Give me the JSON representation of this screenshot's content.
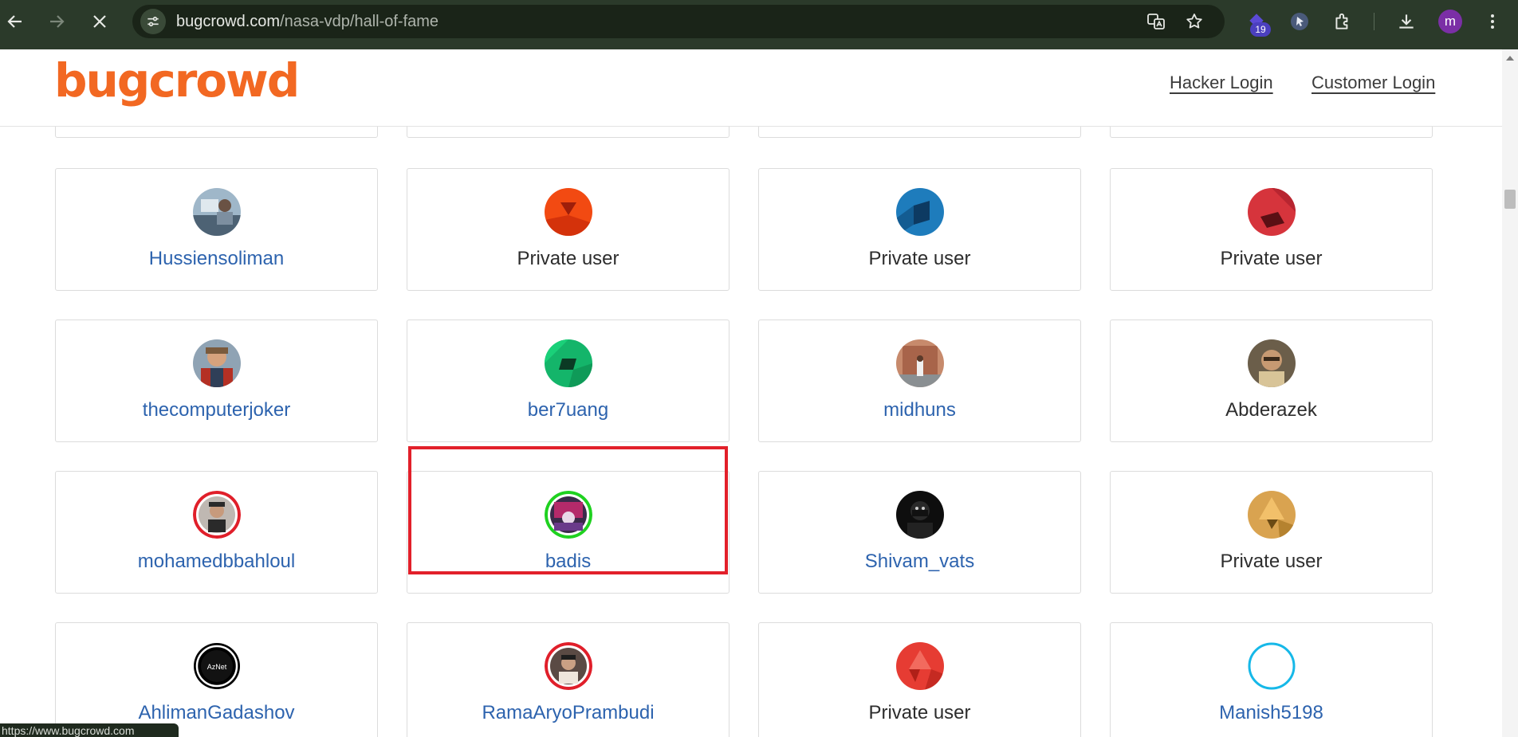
{
  "browser": {
    "url_host": "bugcrowd.com",
    "url_path": "/nasa-vdp/hall-of-fame",
    "extension_badge": "19",
    "profile_initial": "m",
    "status_url": "https://www.bugcrowd.com"
  },
  "header": {
    "logo": "bugcrowd",
    "hacker_login": "Hacker Login",
    "customer_login": "Customer Login"
  },
  "cards": [
    {
      "name": "Hussiensoliman",
      "link": true,
      "avatar": "photo-desk"
    },
    {
      "name": "Private user",
      "link": false,
      "avatar": "geo-red-orange"
    },
    {
      "name": "Private user",
      "link": false,
      "avatar": "geo-blue"
    },
    {
      "name": "Private user",
      "link": false,
      "avatar": "geo-red"
    },
    {
      "name": "thecomputerjoker",
      "link": true,
      "avatar": "photo-person"
    },
    {
      "name": "ber7uang",
      "link": true,
      "avatar": "geo-green"
    },
    {
      "name": "midhuns",
      "link": true,
      "avatar": "photo-street"
    },
    {
      "name": "Abderazek",
      "link": false,
      "avatar": "photo-man"
    },
    {
      "name": "mohamedbbahloul",
      "link": true,
      "avatar": "photo-red-ring"
    },
    {
      "name": "badis",
      "link": true,
      "avatar": "photo-green-ring"
    },
    {
      "name": "Shivam_vats",
      "link": true,
      "avatar": "photo-dark"
    },
    {
      "name": "Private user",
      "link": false,
      "avatar": "geo-gold"
    },
    {
      "name": "AhlimanGadashov",
      "link": true,
      "avatar": "logo-azbek"
    },
    {
      "name": "RamaAryoPrambudi",
      "link": true,
      "avatar": "photo-red-ring-2"
    },
    {
      "name": "Private user",
      "link": false,
      "avatar": "geo-red-2"
    },
    {
      "name": "Manish5198",
      "link": true,
      "avatar": "empty-cyan-ring"
    }
  ],
  "avatar_text": {
    "logo-azbek": "AzNet"
  },
  "colors": {
    "brand": "#f26822",
    "link": "#2d63ae",
    "highlight": "#e2202a"
  }
}
